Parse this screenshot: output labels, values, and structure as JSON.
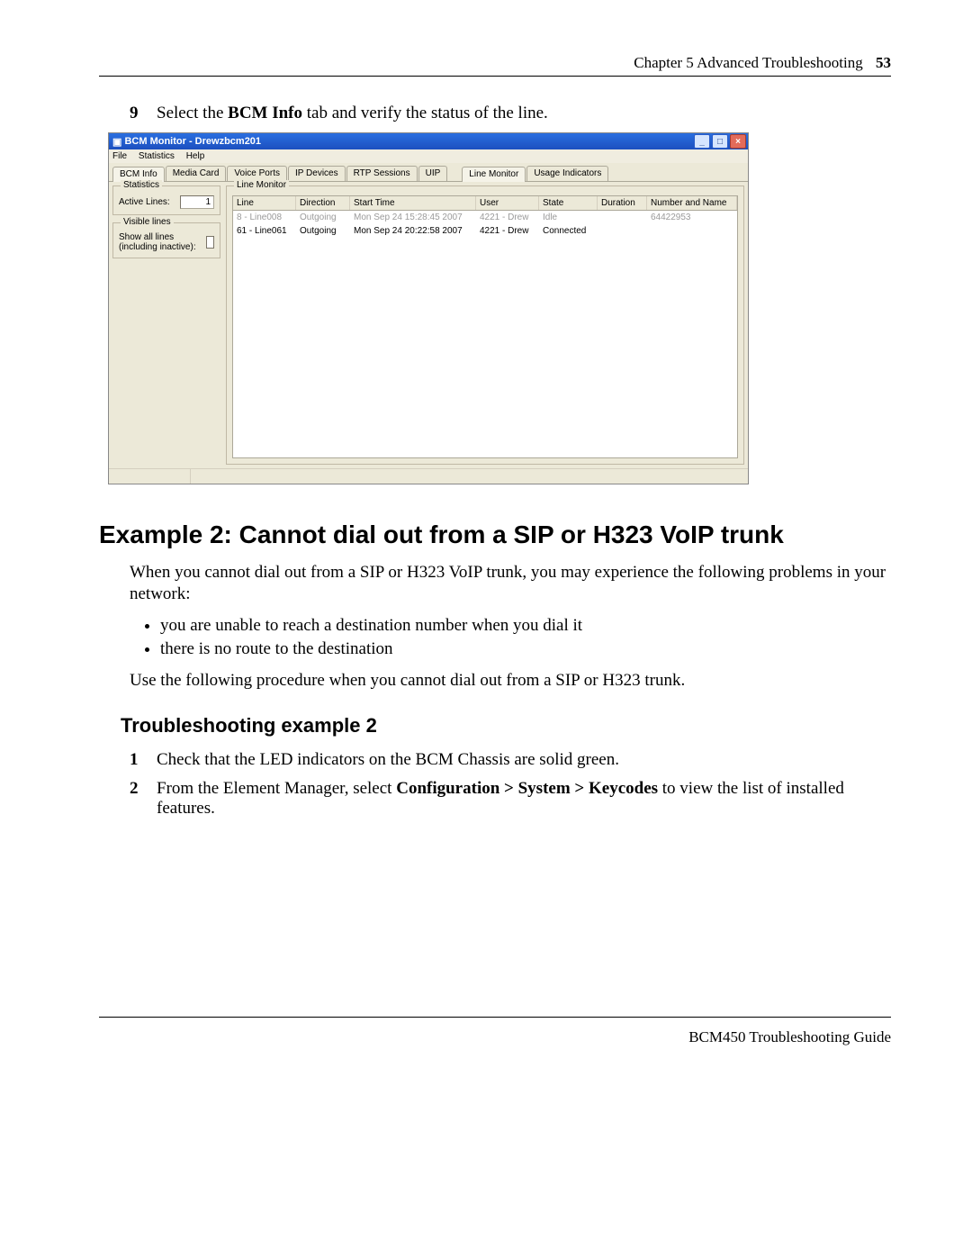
{
  "header": {
    "chapter": "Chapter 5  Advanced Troubleshooting",
    "page": "53"
  },
  "step9": {
    "num": "9",
    "prefix": "Select the ",
    "bold": "BCM Info",
    "suffix": " tab and verify the status of the line."
  },
  "app": {
    "title": "BCM Monitor - Drewzbcm201",
    "menu": {
      "file": "File",
      "statistics": "Statistics",
      "help": "Help"
    },
    "tabs1": [
      "BCM Info",
      "Media Card",
      "Voice Ports",
      "IP Devices",
      "RTP Sessions",
      "UIP"
    ],
    "tabs2": [
      "Line Monitor",
      "Usage Indicators"
    ],
    "statistics_legend": "Statistics",
    "active_lines_label": "Active Lines:",
    "active_lines_value": "1",
    "visible_legend": "Visible lines",
    "show_all_label": "Show all lines (including inactive):",
    "line_monitor_legend": "Line Monitor",
    "columns": {
      "line": "Line",
      "direction": "Direction",
      "start": "Start Time",
      "user": "User",
      "state": "State",
      "duration": "Duration",
      "num": "Number and Name"
    },
    "rows": [
      {
        "line": "8 - Line008",
        "direction": "Outgoing",
        "start": "Mon Sep 24 15:28:45 2007",
        "user": "4221 - Drew",
        "state": "Idle",
        "duration": "",
        "num": "64422953",
        "dim": true
      },
      {
        "line": "61 - Line061",
        "direction": "Outgoing",
        "start": "Mon Sep 24 20:22:58 2007",
        "user": "4221 - Drew",
        "state": "Connected",
        "duration": "",
        "num": "",
        "dim": false
      }
    ]
  },
  "heading2": "Example 2: Cannot dial out from a SIP or H323 VoIP trunk",
  "intro": "When you cannot dial out from a SIP or H323 VoIP trunk, you may experience the following problems in your network:",
  "bullets": [
    "you are unable to reach a destination number when you dial it",
    "there is no route to the destination"
  ],
  "use_proc": "Use the following procedure when you cannot dial out from a SIP or H323 trunk.",
  "heading3": "Troubleshooting example 2",
  "step1": {
    "num": "1",
    "text": "Check that the LED indicators on the BCM Chassis are solid green."
  },
  "step2": {
    "num": "2",
    "prefix": "From the Element Manager, select ",
    "bold": "Configuration > System > Keycodes",
    "suffix": " to view the list of installed features."
  },
  "footer": "BCM450 Troubleshooting Guide"
}
